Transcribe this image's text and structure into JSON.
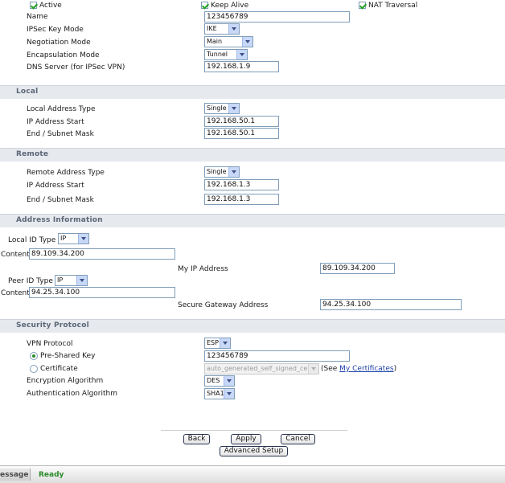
{
  "top": {
    "active_label": "Active",
    "keepalive_label": "Keep Alive",
    "nat_label": "NAT Traversal"
  },
  "general": {
    "name_label": "Name",
    "name_value": "123456789",
    "key_mode_label": "IPSec Key Mode",
    "key_mode_value": "IKE",
    "neg_mode_label": "Negotiation Mode",
    "neg_mode_value": "Main",
    "encap_label": "Encapsulation Mode",
    "encap_value": "Tunnel",
    "dns_label": "DNS Server (for IPSec VPN)",
    "dns_value": "192.168.1.9"
  },
  "local": {
    "title": "Local",
    "addr_type_label": "Local Address Type",
    "addr_type_value": "Single",
    "ip_start_label": "IP Address Start",
    "ip_start_value": "192.168.50.1",
    "end_label": "End / Subnet Mask",
    "end_value": "192.168.50.1"
  },
  "remote": {
    "title": "Remote",
    "addr_type_label": "Remote Address Type",
    "addr_type_value": "Single",
    "ip_start_label": "IP Address Start",
    "ip_start_value": "192.168.1.3",
    "end_label": "End / Subnet Mask",
    "end_value": "192.168.1.3"
  },
  "address_info": {
    "title": "Address Information",
    "local_id_label": "Local ID Type",
    "local_id_value": "IP",
    "content_label": "Content",
    "local_content_value": "89.109.34.200",
    "my_ip_label": "My IP Address",
    "my_ip_value": "89.109.34.200",
    "peer_id_label": "Peer ID Type",
    "peer_id_value": "IP",
    "peer_content_value": "94.25.34.100",
    "gateway_label": "Secure Gateway Address",
    "gateway_value": "94.25.34.100"
  },
  "security": {
    "title": "Security Protocol",
    "vpn_protocol_label": "VPN Protocol",
    "vpn_protocol_value": "ESP",
    "psk_label": "Pre-Shared Key",
    "psk_value": "123456789",
    "cert_label": "Certificate",
    "cert_value": "auto_generated_self_signed_cert",
    "see_prefix": "(See ",
    "see_link": "My Certificates",
    "see_suffix": ")",
    "enc_label": "Encryption Algorithm",
    "enc_value": "DES",
    "auth_label": "Authentication Algorithm",
    "auth_value": "SHA1"
  },
  "buttons": {
    "back": "Back",
    "apply": "Apply",
    "cancel": "Cancel",
    "advanced": "Advanced Setup"
  },
  "status": {
    "label": "essage",
    "value": "Ready"
  },
  "colors": {
    "section_bg": "#e6e9ee",
    "section_text": "#5b6676",
    "status_ready": "#2a8a2a",
    "link": "#1a3fa8"
  }
}
